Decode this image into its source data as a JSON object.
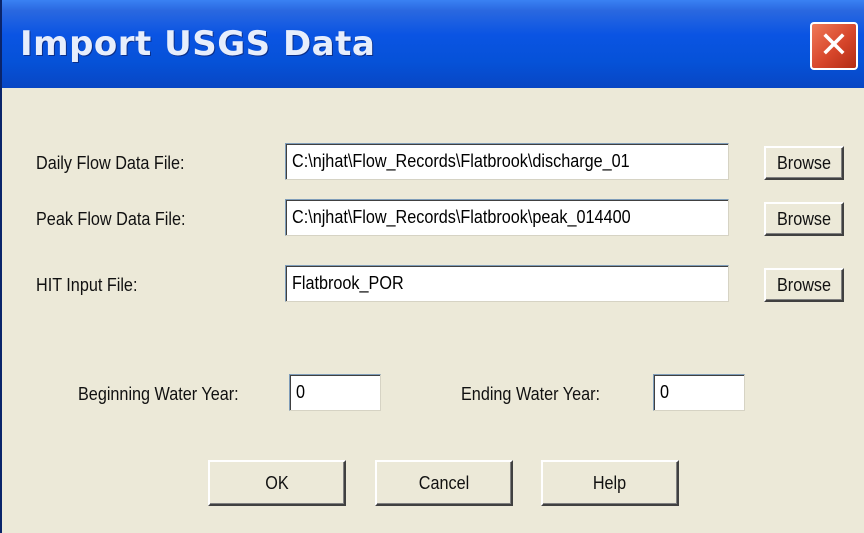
{
  "window": {
    "title": "Import USGS Data",
    "close_icon_glyph": "✕"
  },
  "form": {
    "daily_flow": {
      "label": "Daily Flow Data File:",
      "value": "C:\\njhat\\Flow_Records\\Flatbrook\\discharge_01",
      "browse_label": "Browse"
    },
    "peak_flow": {
      "label": "Peak Flow Data File:",
      "value": "C:\\njhat\\Flow_Records\\Flatbrook\\peak_014400",
      "browse_label": "Browse"
    },
    "hit_input": {
      "label": "HIT Input File:",
      "value": "Flatbrook_POR",
      "browse_label": "Browse"
    },
    "beginning_year": {
      "label": "Beginning Water Year:",
      "value": "0"
    },
    "ending_year": {
      "label": "Ending Water Year:",
      "value": "0"
    }
  },
  "buttons": {
    "ok": "OK",
    "cancel": "Cancel",
    "help": "Help"
  },
  "colors": {
    "titlebar": "#0a54e3",
    "dialog_bg": "#ece9d8",
    "close_button": "#d7462b"
  }
}
